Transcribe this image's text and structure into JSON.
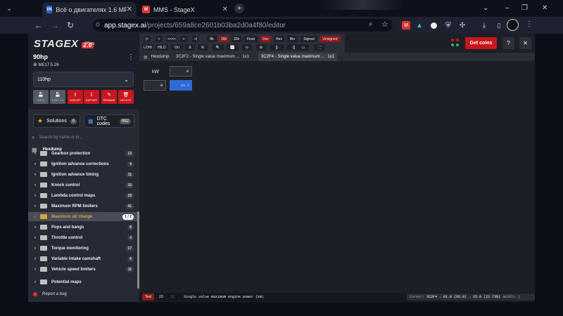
{
  "browser": {
    "tabs": [
      {
        "favicon": "VK",
        "label": "Всё о двигателях 1.6 MPI (EA2..."
      },
      {
        "favicon": "M",
        "label": "MMS - StageX"
      }
    ],
    "new_tab": "+",
    "url_host": "app.stagex.ai",
    "url_path": "/projects/659a8ce2601b03ba2d0a4f80/editor",
    "window_controls": [
      "⌄",
      "–",
      "❐",
      "✕"
    ]
  },
  "sidebar": {
    "logo": "STAGEX",
    "logo_version": "2.0",
    "logo_plus": "Plus",
    "project_name": "90hp",
    "ecu": "ME17.5.26",
    "variant": "110hp",
    "actions": [
      {
        "label": "SAVE",
        "icon": "💾"
      },
      {
        "label": "SAVE AS",
        "icon": "💾"
      },
      {
        "label": "IMPORT",
        "icon": "⇧"
      },
      {
        "label": "EXPORT",
        "icon": "⇩"
      },
      {
        "label": "RENAME",
        "icon": "✎"
      },
      {
        "label": "DELETE",
        "icon": "🗑"
      }
    ],
    "solutions_label": "Solutions",
    "solutions_count": "0",
    "dtc_label": "DTC codes",
    "dtc_count": "992",
    "search_placeholder": "Search by name or id...",
    "hexdump_label": "Hexdump",
    "tree": [
      {
        "label": "Gearbox protection",
        "count": "13"
      },
      {
        "label": "Ignition advance corrections",
        "count": "4"
      },
      {
        "label": "Ignition advance timing",
        "count": "11"
      },
      {
        "label": "Knock control",
        "count": "15"
      },
      {
        "label": "Lambda control maps",
        "count": "19"
      },
      {
        "label": "Maximum RPM limiters",
        "count": "41"
      },
      {
        "label": "Maximum air charge",
        "count": "1 / 2"
      },
      {
        "label": "Pops and bangs",
        "count": "8"
      },
      {
        "label": "Throttle control",
        "count": "4"
      },
      {
        "label": "Torque monitoring",
        "count": "17"
      },
      {
        "label": "Variable intake camshaft",
        "count": "6"
      },
      {
        "label": "Vehicle speed limiters",
        "count": "11"
      },
      {
        "label": "Potential maps",
        "count": ""
      }
    ],
    "report_bug": "Report a bug"
  },
  "toolbar": {
    "row1": [
      "|<",
      "<",
      "<<<<",
      ">",
      ">|",
      "8b",
      "16b",
      "32b",
      "Float",
      "Dec",
      "Hex",
      "Bin",
      "Signed",
      "Unsigned"
    ],
    "row2": [
      "LOHI",
      "HILO",
      "Ori",
      "Δ",
      "%",
      "🔍",
      "📈",
      "⊙",
      "⚙",
      "[]·",
      "·[]",
      "▭",
      "⛶"
    ]
  },
  "editor_tabs": [
    {
      "label": "Hexdump"
    },
    {
      "label": "3C2F2 - Single value maximum ...",
      "dims": "1x1"
    },
    {
      "label": "3C2F4 - Single value maximum ...",
      "dims": "1x1"
    }
  ],
  "map": {
    "unit": "kW",
    "axis_value": "0",
    "row_header": "0",
    "cell_value": "81.0"
  },
  "bottom": {
    "modes": [
      "Text",
      "2D",
      "3D"
    ],
    "map_name": "Single value maximum engine power (kW)",
    "cursor_label": "Cursor:",
    "cursor_value": "3C2F4 → 81.0 (66.0) → 15.0 (22.73%)",
    "width": "Width: 1"
  },
  "header_right": {
    "get_coins": "Get coins",
    "help": "?",
    "close": "✕"
  }
}
